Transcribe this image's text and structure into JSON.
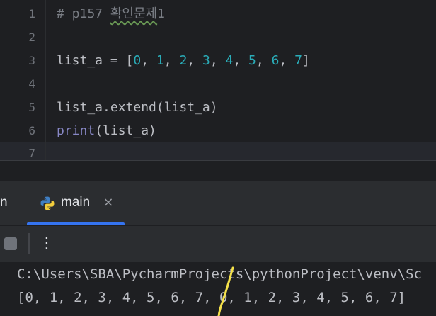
{
  "editor": {
    "line_numbers": [
      "1",
      "2",
      "3",
      "4",
      "5",
      "6",
      "7"
    ],
    "line1": {
      "hash": "# p157 ",
      "korean": "확인문제",
      "tail": "1"
    },
    "line3": {
      "prefix": "list_a = [",
      "nums": [
        "0",
        "1",
        "2",
        "3",
        "4",
        "5",
        "6",
        "7"
      ],
      "sep": ", ",
      "suffix": "]"
    },
    "line5": "list_a.extend(list_a)",
    "line6": {
      "func": "print",
      "args": "(list_a)"
    }
  },
  "run": {
    "cut_title": "n",
    "tab_label": "main",
    "close_symbol": "×",
    "more_symbol": "⋮"
  },
  "console": {
    "line1": "C:\\Users\\SBA\\PycharmProjects\\pythonProject\\venv\\Sc",
    "line2": "[0, 1, 2, 3, 4, 5, 6, 7, 0, 1, 2, 3, 4, 5, 6, 7]"
  },
  "colors": {
    "background": "#1e1f22",
    "panel": "#2b2d30",
    "number": "#2aacb8",
    "builtin": "#8888c6",
    "comment": "#7a7e85",
    "accent": "#3574f0",
    "annotation_stroke": "#f5e14a"
  },
  "icons": {
    "tab_icon": "python-logo-icon",
    "stop": "stop-icon",
    "more": "more-vertical-icon"
  }
}
